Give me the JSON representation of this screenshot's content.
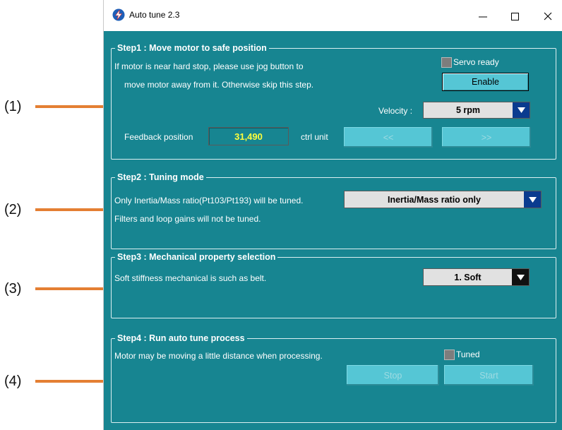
{
  "callouts": [
    "(1)",
    "(2)",
    "(3)",
    "(4)"
  ],
  "window": {
    "title": "Auto tune 2.3"
  },
  "step1": {
    "legend": "Step1 : Move motor to safe position",
    "line1": "If motor is near hard stop, please use jog button to",
    "line2": "move motor away from it. Otherwise skip this step.",
    "servo_ready_label": "Servo ready",
    "enable_label": "Enable",
    "velocity_label": "Velocity :",
    "velocity_value": "5 rpm",
    "feedback_label": "Feedback position",
    "feedback_value": "31,490",
    "unit_label": "ctrl unit",
    "jog_reverse_label": "<<",
    "jog_forward_label": ">>"
  },
  "step2": {
    "legend": "Step2 : Tuning mode",
    "line1": "Only Inertia/Mass ratio(Pt103/Pt193) will be tuned.",
    "line2": "Filters and loop gains will not be tuned.",
    "mode_value": "Inertia/Mass ratio only"
  },
  "step3": {
    "legend": "Step3 : Mechanical property selection",
    "line1": "Soft stiffness mechanical is such as belt.",
    "property_value": "1. Soft"
  },
  "step4": {
    "legend": "Step4 : Run auto tune process",
    "line1": "Motor may be moving a little distance when processing.",
    "tuned_label": "Tuned",
    "stop_label": "Stop",
    "start_label": "Start"
  },
  "colors": {
    "client_bg": "#178591",
    "button_face": "#55c6d5",
    "callout_line": "#e47f33",
    "feedback_text": "#ffff3c",
    "combo_arrow_blue": "#0a3b8f"
  },
  "icons": [
    "app-lightning-icon",
    "minimize-icon",
    "maximize-icon",
    "close-icon",
    "dropdown-arrow-icon"
  ]
}
